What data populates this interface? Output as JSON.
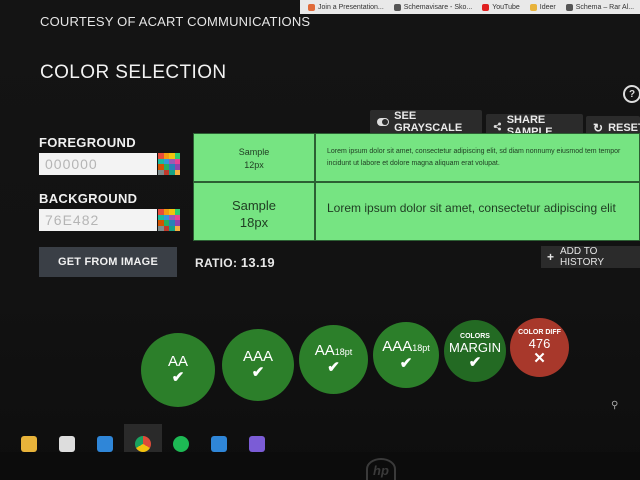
{
  "bookmarks": [
    {
      "label": "Join a Presentation...",
      "color": "#e06b3a"
    },
    {
      "label": "Schemavisare - Sko...",
      "color": "#555555"
    },
    {
      "label": "YouTube",
      "color": "#e02020"
    },
    {
      "label": "Ideer",
      "color": "#e8b33a"
    },
    {
      "label": "Schema – Rar Al...",
      "color": "#555555"
    }
  ],
  "header": {
    "courtesy": "COURTESY OF ACART COMMUNICATIONS",
    "title": "COLOR SELECTION",
    "help_icon": "?"
  },
  "toolbar": {
    "grayscale_label": "SEE GRAYSCALE",
    "share_label": "SHARE SAMPLE",
    "reset_label": "RESET"
  },
  "foreground": {
    "label": "FOREGROUND",
    "placeholder": "000000",
    "color": "#000000"
  },
  "background": {
    "label": "BACKGROUND",
    "placeholder": "76E482",
    "color": "#76e482"
  },
  "get_from_image": "GET FROM IMAGE",
  "sample": {
    "small_title": "Sample",
    "small_size": "12px",
    "large_title": "Sample",
    "large_size": "18px",
    "small_text": "Lorem ipsum dolor sit amet, consectetur adipiscing elit, sd diam nonnumy eiusmod tem tempor incidunt ut labore et dolore magna aliquam erat volupat.",
    "large_text": "Lorem ipsum dolor sit amet, consectetur adipiscing elit"
  },
  "ratio": {
    "label": "RATIO:",
    "value": "13.19"
  },
  "add_history": {
    "icon": "+",
    "label": "ADD TO HISTORY"
  },
  "results": [
    {
      "small": "",
      "main": "AA",
      "suffix": "",
      "mark": "✔",
      "status": "pass",
      "color": "#2c7f2a"
    },
    {
      "small": "",
      "main": "AAA",
      "suffix": "",
      "mark": "✔",
      "status": "pass",
      "color": "#2c7f2a"
    },
    {
      "small": "",
      "main": "AA",
      "suffix": "18pt",
      "mark": "✔",
      "status": "pass",
      "color": "#2c7f2a"
    },
    {
      "small": "",
      "main": "AAA",
      "suffix": "18pt",
      "mark": "✔",
      "status": "pass",
      "color": "#2c7f2a"
    },
    {
      "small": "COLORS",
      "main": "MARGIN",
      "suffix": "",
      "mark": "✔",
      "status": "pass",
      "color": "#236a23"
    },
    {
      "small": "COLOR DIFF",
      "main": "476",
      "suffix": "",
      "mark": "✕",
      "status": "fail",
      "color": "#a8382b"
    }
  ],
  "taskbar": [
    {
      "icon": "file-explorer-icon",
      "color": "#e8b33a",
      "state": "active"
    },
    {
      "icon": "store-icon",
      "color": "#dddddd",
      "state": ""
    },
    {
      "icon": "mail-icon",
      "color": "#2f86d8",
      "state": ""
    },
    {
      "icon": "chrome-icon",
      "color": "#dd4b39",
      "state": "open"
    },
    {
      "icon": "spotify-icon",
      "color": "#1db954",
      "state": "open"
    },
    {
      "icon": "vscode-icon",
      "color": "#2f86d8",
      "state": "open"
    },
    {
      "icon": "github-icon",
      "color": "#7b5cd6",
      "state": "open"
    }
  ]
}
